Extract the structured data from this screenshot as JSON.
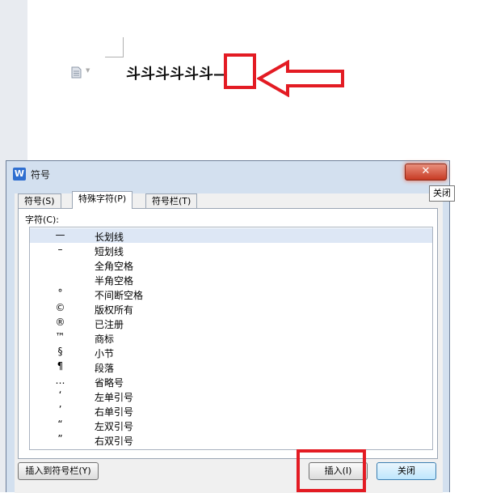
{
  "document": {
    "text": "斗斗斗斗斗斗—"
  },
  "dialog": {
    "title": "符号",
    "close_symbol": "✕",
    "close_tooltip": "关闭",
    "tabs": [
      {
        "label": "符号(S)"
      },
      {
        "label": "特殊字符(P)",
        "active": true
      },
      {
        "label": "符号栏(T)"
      }
    ],
    "characters_label": "字符(C):",
    "characters": [
      {
        "glyph": "—",
        "name": "长划线",
        "selected": true
      },
      {
        "glyph": "–",
        "name": "短划线"
      },
      {
        "glyph": "",
        "name": "全角空格"
      },
      {
        "glyph": "",
        "name": "半角空格"
      },
      {
        "glyph": "°",
        "name": "不间断空格"
      },
      {
        "glyph": "©",
        "name": "版权所有"
      },
      {
        "glyph": "®",
        "name": "已注册"
      },
      {
        "glyph": "™",
        "name": "商标"
      },
      {
        "glyph": "§",
        "name": "小节"
      },
      {
        "glyph": "¶",
        "name": "段落"
      },
      {
        "glyph": "…",
        "name": "省略号"
      },
      {
        "glyph": "‘",
        "name": "左单引号"
      },
      {
        "glyph": "’",
        "name": "右单引号"
      },
      {
        "glyph": "“",
        "name": "左双引号"
      },
      {
        "glyph": "”",
        "name": "右双引号"
      }
    ],
    "buttons": {
      "insert_to_bar": "插入到符号栏(Y)",
      "insert": "插入(I)",
      "close": "关闭"
    }
  },
  "colors": {
    "highlight_red": "#e31b23",
    "selection": "#dde7f5"
  }
}
